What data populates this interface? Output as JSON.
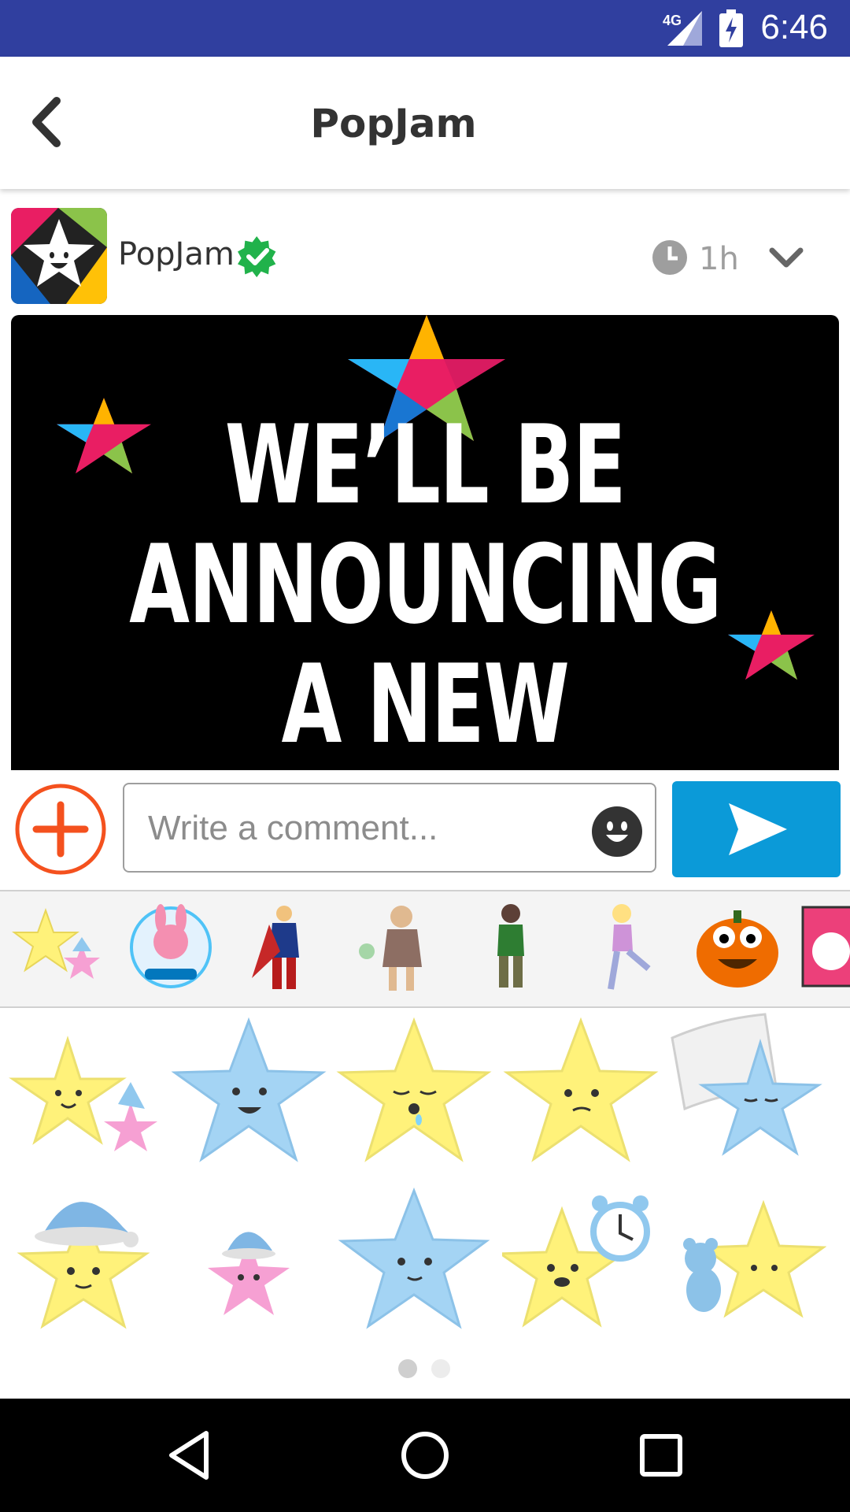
{
  "status_bar": {
    "time": "6:46",
    "network": "4G"
  },
  "app_bar": {
    "title": "PopJam"
  },
  "post": {
    "author": "PopJam",
    "time_ago": "1h",
    "banner_lines": [
      "WE’LL BE",
      "ANNOUNCING",
      "A NEW"
    ]
  },
  "comment": {
    "placeholder": "Write a comment..."
  },
  "icons": [
    "back-arrow-icon",
    "verified-icon",
    "clock-icon",
    "chevron-down-icon",
    "add-circle-icon",
    "emoji-icon",
    "send-icon",
    "nav-back-icon",
    "nav-home-icon",
    "nav-recents-icon"
  ],
  "sticker_pages": {
    "count": 2,
    "active_index": 0
  },
  "colors": {
    "status_bar": "#303f9f",
    "send_button": "#0b9ad8",
    "add_button": "#f4511e",
    "verified": "#21b24b"
  }
}
